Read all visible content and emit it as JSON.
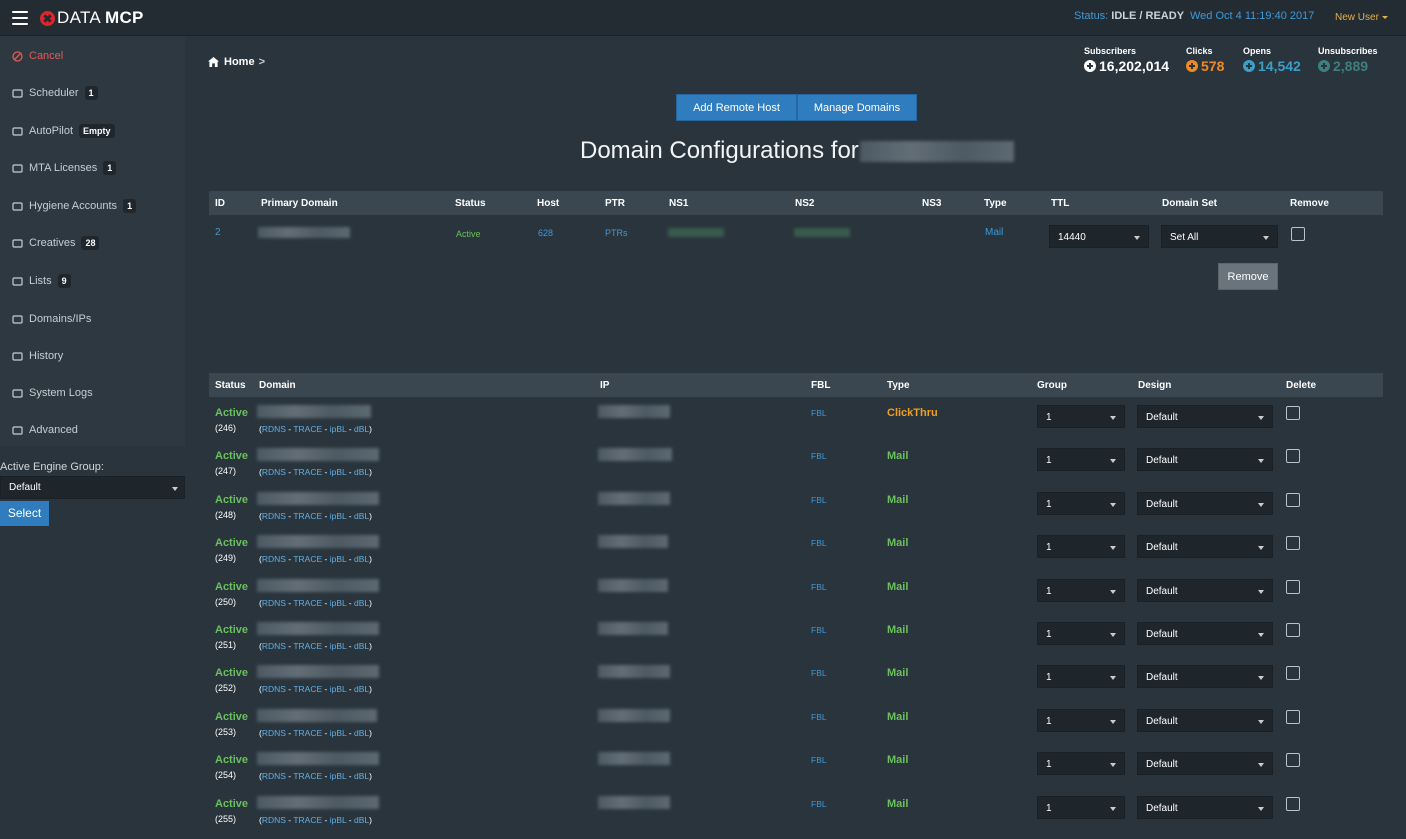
{
  "topbar": {
    "logo_left": "DATA",
    "logo_right": "MCP",
    "status_label": "Status: ",
    "status_value": "IDLE / READY",
    "datetime": "Wed Oct 4 11:19:40 2017",
    "user_menu": "New User"
  },
  "sidebar": {
    "items": [
      {
        "label": "Cancel",
        "badge": ""
      },
      {
        "label": "Scheduler",
        "badge": "1"
      },
      {
        "label": "AutoPilot",
        "badge": "Empty"
      },
      {
        "label": "MTA Licenses",
        "badge": "1"
      },
      {
        "label": "Hygiene Accounts",
        "badge": "1"
      },
      {
        "label": "Creatives",
        "badge": "28"
      },
      {
        "label": "Lists",
        "badge": "9"
      },
      {
        "label": "Domains/IPs",
        "badge": ""
      },
      {
        "label": "History",
        "badge": ""
      },
      {
        "label": "System Logs",
        "badge": ""
      },
      {
        "label": "Advanced",
        "badge": ""
      }
    ],
    "engine_group_label": "Active Engine Group:",
    "engine_group_value": "Default",
    "select_button": "Select"
  },
  "breadcrumb": {
    "home": "Home",
    "sep": ">"
  },
  "stats": {
    "subscribers": {
      "label": "Subscribers",
      "value": "16,202,014",
      "color": "#ffffff"
    },
    "clicks": {
      "label": "Clicks",
      "value": "578",
      "color": "#f08a24"
    },
    "opens": {
      "label": "Opens",
      "value": "14,542",
      "color": "#3aa0c8"
    },
    "unsubscribes": {
      "label": "Unsubscribes",
      "value": "2,889",
      "color": "#3e7f7f"
    }
  },
  "actions": {
    "add_remote_host": "Add Remote Host",
    "manage_domains": "Manage Domains"
  },
  "page_title": "Domain Configurations for",
  "config_table": {
    "headers": {
      "id": "ID",
      "primary_domain": "Primary Domain",
      "status": "Status",
      "host": "Host",
      "ptr": "PTR",
      "ns1": "NS1",
      "ns2": "NS2",
      "ns3": "NS3",
      "type": "Type",
      "ttl": "TTL",
      "domain_set": "Domain Set",
      "remove": "Remove"
    },
    "row": {
      "id": "2",
      "status": "Active",
      "host": "628",
      "ptr": "PTRs",
      "type": "Mail",
      "ttl": "14440",
      "domain_set": "Set All"
    },
    "remove_button": "Remove"
  },
  "domains_table": {
    "headers": {
      "status": "Status",
      "domain": "Domain",
      "ip": "IP",
      "fbl": "FBL",
      "type": "Type",
      "group": "Group",
      "design": "Design",
      "delete": "Delete"
    },
    "link_labels": {
      "rdns": "RDNS",
      "trace": "TRACE",
      "ipbl": "ipBL",
      "dbl": "dBL"
    },
    "rows": [
      {
        "status": "Active",
        "num": "(246)",
        "fbl": "FBL",
        "type": "ClickThru",
        "group": "1",
        "design": "Default"
      },
      {
        "status": "Active",
        "num": "(247)",
        "fbl": "FBL",
        "type": "Mail",
        "group": "1",
        "design": "Default"
      },
      {
        "status": "Active",
        "num": "(248)",
        "fbl": "FBL",
        "type": "Mail",
        "group": "1",
        "design": "Default"
      },
      {
        "status": "Active",
        "num": "(249)",
        "fbl": "FBL",
        "type": "Mail",
        "group": "1",
        "design": "Default"
      },
      {
        "status": "Active",
        "num": "(250)",
        "fbl": "FBL",
        "type": "Mail",
        "group": "1",
        "design": "Default"
      },
      {
        "status": "Active",
        "num": "(251)",
        "fbl": "FBL",
        "type": "Mail",
        "group": "1",
        "design": "Default"
      },
      {
        "status": "Active",
        "num": "(252)",
        "fbl": "FBL",
        "type": "Mail",
        "group": "1",
        "design": "Default"
      },
      {
        "status": "Active",
        "num": "(253)",
        "fbl": "FBL",
        "type": "Mail",
        "group": "1",
        "design": "Default"
      },
      {
        "status": "Active",
        "num": "(254)",
        "fbl": "FBL",
        "type": "Mail",
        "group": "1",
        "design": "Default"
      },
      {
        "status": "Active",
        "num": "(255)",
        "fbl": "FBL",
        "type": "Mail",
        "group": "1",
        "design": "Default"
      }
    ]
  }
}
